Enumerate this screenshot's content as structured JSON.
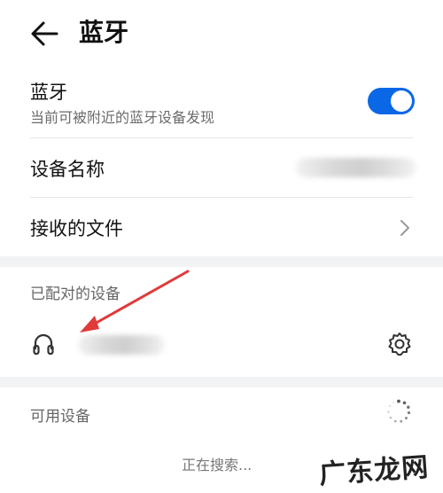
{
  "header": {
    "title": "蓝牙"
  },
  "bluetooth": {
    "title": "蓝牙",
    "subtitle": "当前可被附近的蓝牙设备发现",
    "enabled": true
  },
  "device_name": {
    "label": "设备名称"
  },
  "received_files": {
    "label": "接收的文件"
  },
  "paired": {
    "section_label": "已配对的设备"
  },
  "available": {
    "section_label": "可用设备",
    "searching_text": "正在搜索..."
  },
  "watermark": {
    "text": "广东龙网"
  },
  "colors": {
    "accent": "#0a67e6",
    "arrow": "#e03a3a"
  }
}
